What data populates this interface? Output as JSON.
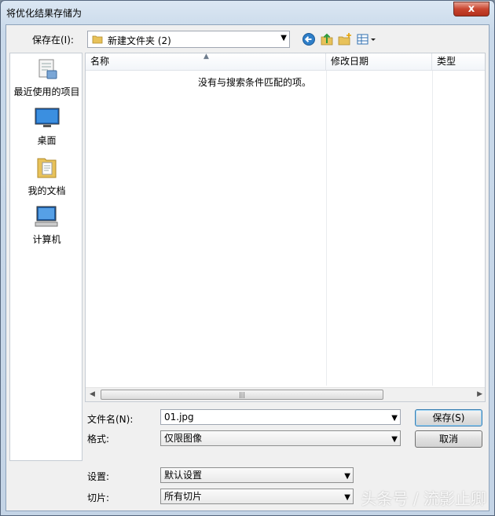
{
  "window": {
    "title": "将优化结果存储为",
    "close_glyph": "x"
  },
  "toolbar": {
    "save_in_label": "保存在(I):",
    "current_folder": "新建文件夹 (2)",
    "icons": [
      "back-arrow-icon",
      "up-folder-icon",
      "new-folder-icon",
      "view-menu-icon"
    ]
  },
  "places": [
    {
      "label": "最近使用的项目",
      "icon": "recent-items-icon"
    },
    {
      "label": "桌面",
      "icon": "desktop-icon"
    },
    {
      "label": "我的文档",
      "icon": "documents-icon"
    },
    {
      "label": "计算机",
      "icon": "computer-icon"
    }
  ],
  "filelist": {
    "columns": [
      "名称",
      "修改日期",
      "类型"
    ],
    "empty_message": "没有与搜索条件匹配的项。"
  },
  "form": {
    "filename_label": "文件名(N):",
    "filename_value": "01.jpg",
    "format_label": "格式:",
    "format_value": "仅限图像",
    "settings_label": "设置:",
    "settings_value": "默认设置",
    "slices_label": "切片:",
    "slices_value": "所有切片"
  },
  "buttons": {
    "save": "保存(S)",
    "cancel": "取消"
  },
  "watermark": "头条号 / 流影止卿",
  "colors": {
    "title_bar": "#c9d9ea",
    "close_button": "#c8452f",
    "default_button_border": "#3c7fb1"
  }
}
